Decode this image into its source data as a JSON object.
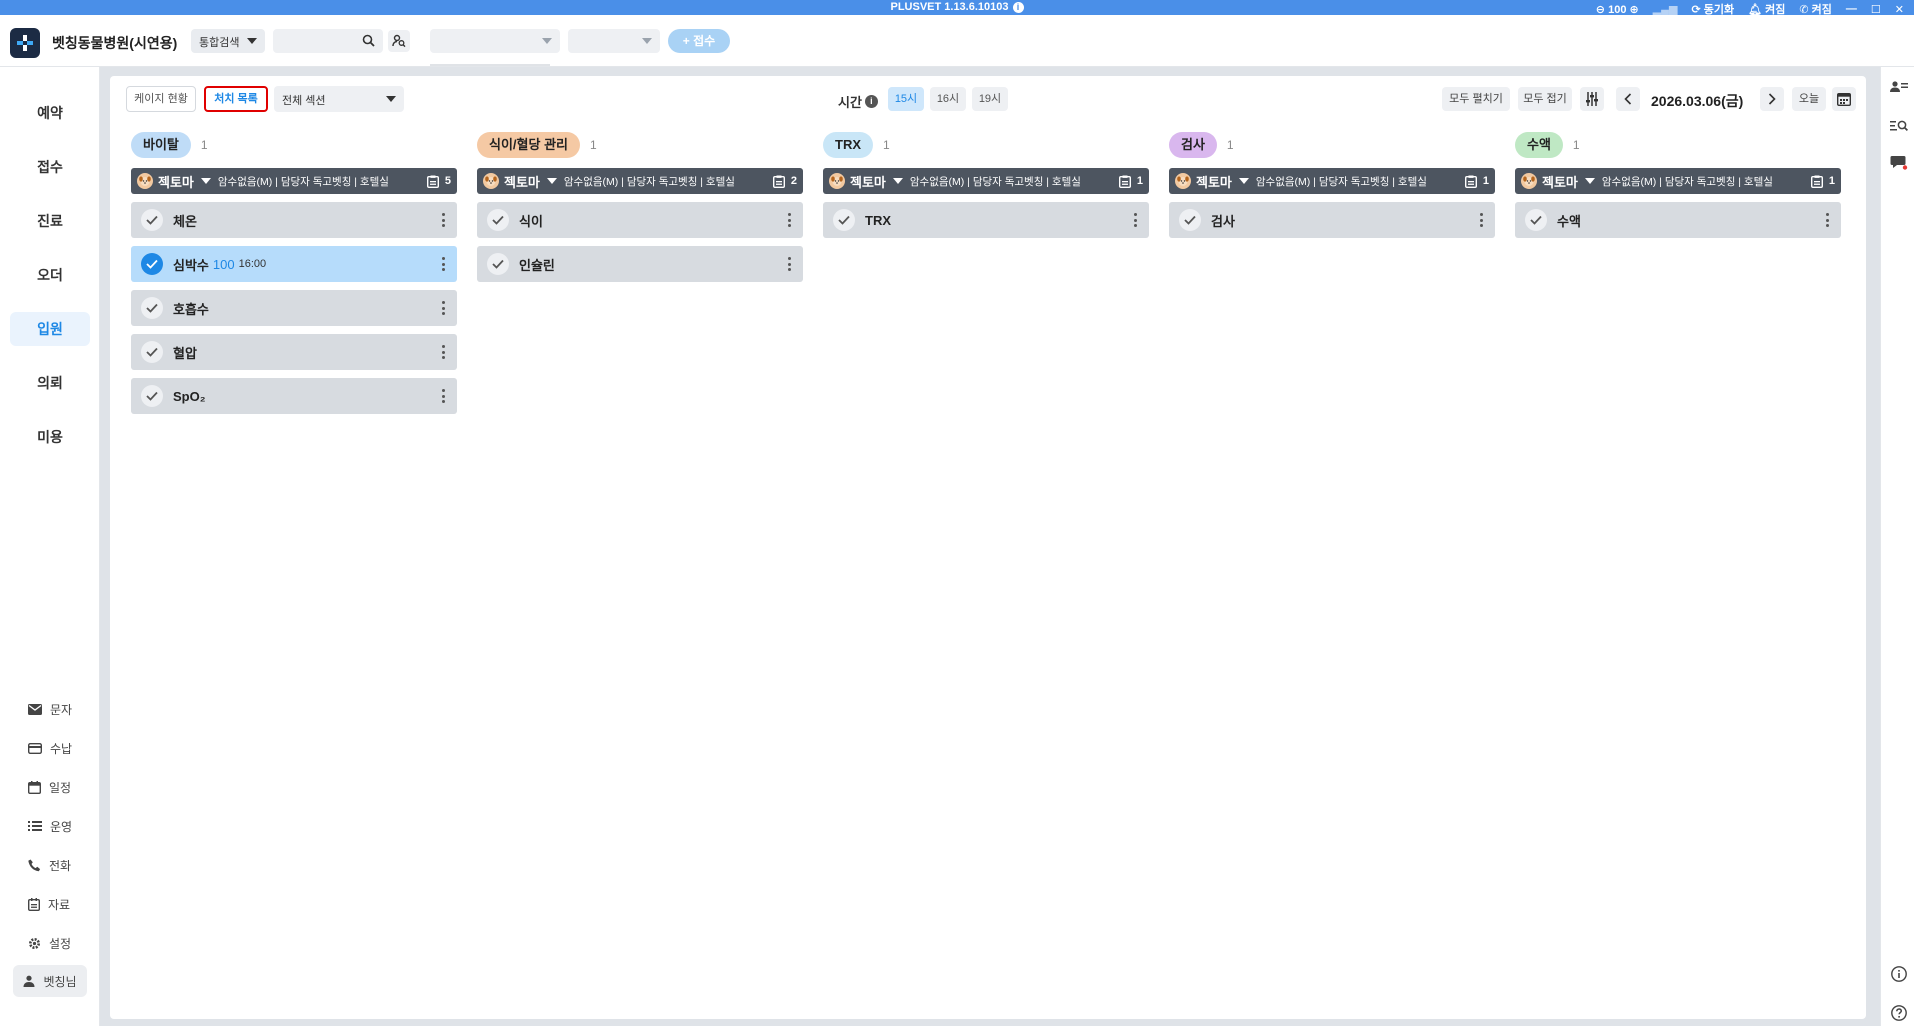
{
  "titlebar": {
    "app_title": "PLUSVET 1.13.6.10103",
    "zoom": "100",
    "sync_label": "동기화",
    "notice_label": "켜짐",
    "phone_label": "켜짐"
  },
  "toolbar": {
    "hospital_name": "벳칭동물병원(시연용)",
    "search_type": "통합검색",
    "add_label": "+ 접수"
  },
  "sidebar": {
    "nav": [
      {
        "label": "예약"
      },
      {
        "label": "접수"
      },
      {
        "label": "진료"
      },
      {
        "label": "오더"
      },
      {
        "label": "입원"
      },
      {
        "label": "의뢰"
      },
      {
        "label": "미용"
      }
    ],
    "sub": [
      {
        "label": "문자",
        "icon": "mail-icon"
      },
      {
        "label": "수납",
        "icon": "card-icon"
      },
      {
        "label": "일정",
        "icon": "calendar-icon"
      },
      {
        "label": "운영",
        "icon": "list-icon"
      },
      {
        "label": "전화",
        "icon": "phone-icon"
      },
      {
        "label": "자료",
        "icon": "document-icon"
      },
      {
        "label": "설정",
        "icon": "gear-icon"
      }
    ],
    "user": "벳칭님"
  },
  "header": {
    "tab_cage": "케이지 현황",
    "tab_treatment": "처치 목록",
    "section_select": "전체 섹션",
    "time_label": "시간",
    "time_slots": [
      "15시",
      "16시",
      "19시"
    ],
    "expand_all": "모두 펼치기",
    "collapse_all": "모두 접기",
    "date": "2026.03.06(금)",
    "today": "오늘"
  },
  "colors": {
    "accent": "#1e88e5",
    "vital": "#bfdcf7",
    "feeding": "#f5c9a4",
    "trx": "#c9e6f7",
    "test": "#d9b7ee",
    "fluid": "#bfe8c4"
  },
  "columns": [
    {
      "category": "바이탈",
      "count": "1",
      "color": "#bfdcf7",
      "patient": {
        "name": "젝토마",
        "info": "암수없음(M) | 담당자 독고벳칭 | 호텔실",
        "doc_count": "5"
      },
      "tasks": [
        {
          "name": "체온",
          "value": "",
          "time": "",
          "done": false
        },
        {
          "name": "심박수",
          "value": "100",
          "time": "16:00",
          "done": true
        },
        {
          "name": "호흡수",
          "value": "",
          "time": "",
          "done": false
        },
        {
          "name": "혈압",
          "value": "",
          "time": "",
          "done": false
        },
        {
          "name": "SpO₂",
          "value": "",
          "time": "",
          "done": false
        }
      ]
    },
    {
      "category": "식이/혈당 관리",
      "count": "1",
      "color": "#f5c9a4",
      "patient": {
        "name": "젝토마",
        "info": "암수없음(M) | 담당자 독고벳칭 | 호텔실",
        "doc_count": "2"
      },
      "tasks": [
        {
          "name": "식이",
          "value": "",
          "time": "",
          "done": false
        },
        {
          "name": "인슐린",
          "value": "",
          "time": "",
          "done": false
        }
      ]
    },
    {
      "category": "TRX",
      "count": "1",
      "color": "#c9e6f7",
      "patient": {
        "name": "젝토마",
        "info": "암수없음(M) | 담당자 독고벳칭 | 호텔실",
        "doc_count": "1"
      },
      "tasks": [
        {
          "name": "TRX",
          "value": "",
          "time": "",
          "done": false
        }
      ]
    },
    {
      "category": "검사",
      "count": "1",
      "color": "#d9b7ee",
      "patient": {
        "name": "젝토마",
        "info": "암수없음(M) | 담당자 독고벳칭 | 호텔실",
        "doc_count": "1"
      },
      "tasks": [
        {
          "name": "검사",
          "value": "",
          "time": "",
          "done": false
        }
      ]
    },
    {
      "category": "수액",
      "count": "1",
      "color": "#bfe8c4",
      "patient": {
        "name": "젝토마",
        "info": "암수없음(M) | 담당자 독고벳칭 | 호텔실",
        "doc_count": "1"
      },
      "tasks": [
        {
          "name": "수액",
          "value": "",
          "time": "",
          "done": false
        }
      ]
    }
  ]
}
